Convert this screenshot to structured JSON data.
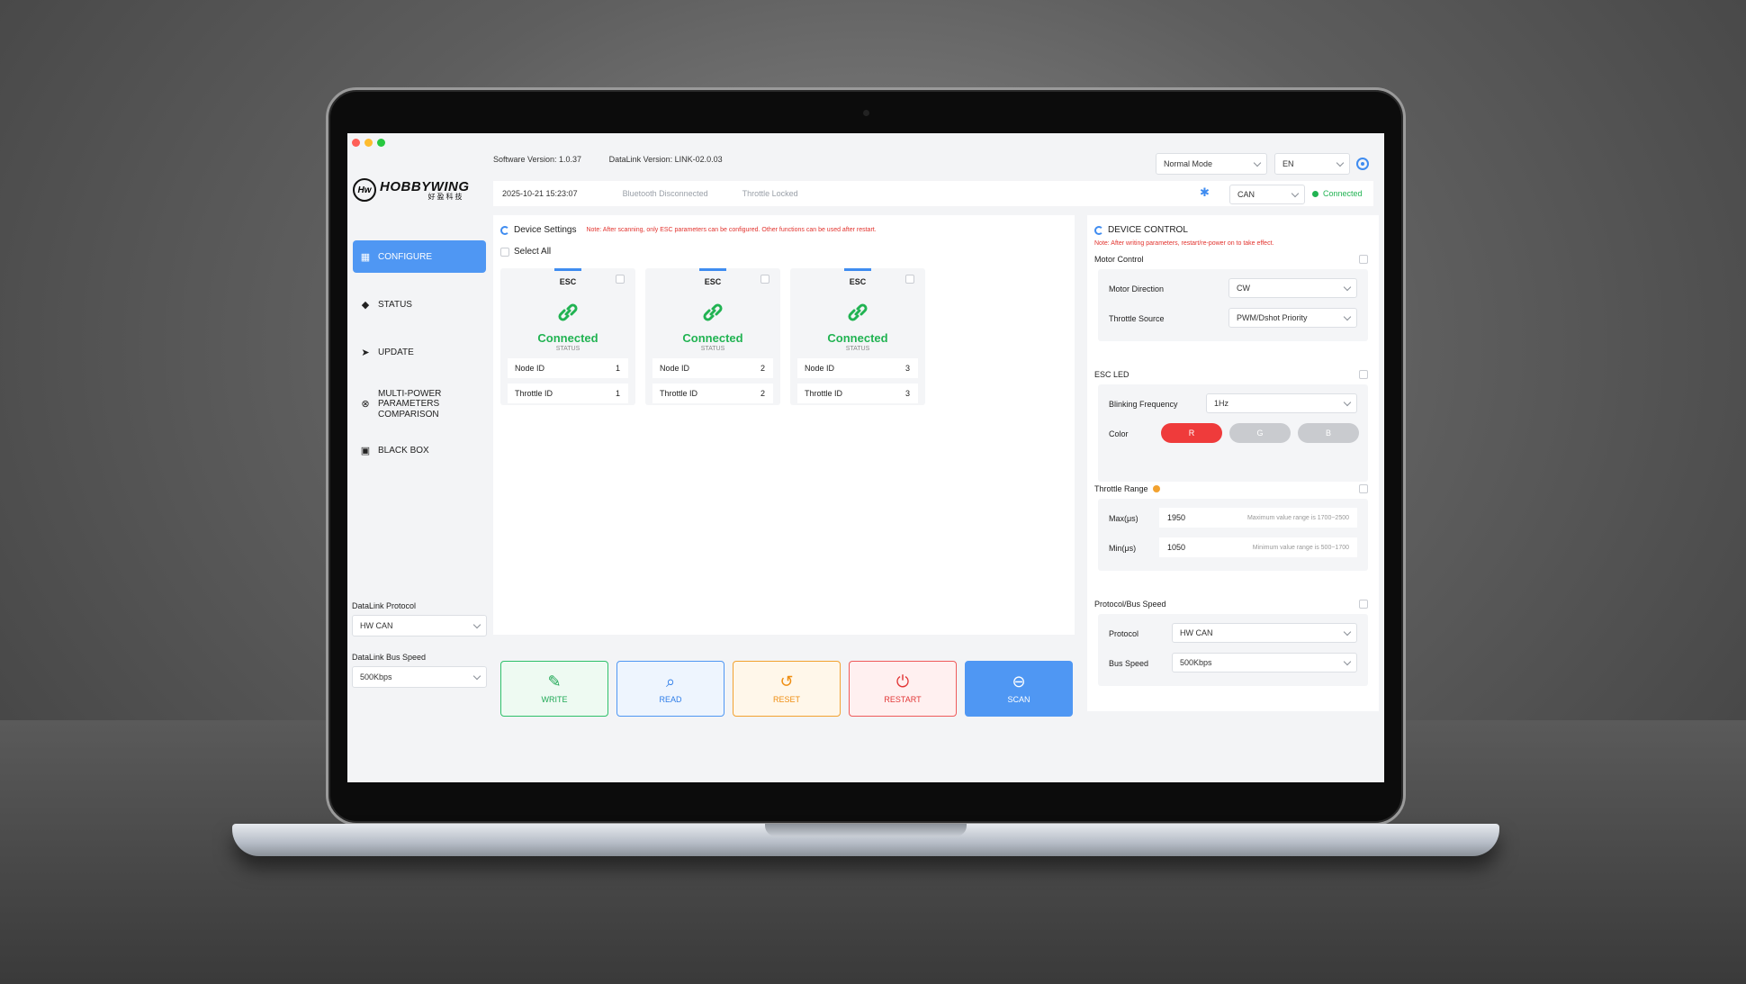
{
  "header": {
    "software_version": "Software Version:  1.0.37",
    "datalink_version": "DataLink Version:  LINK-02.0.03",
    "datetime": "2025-10-21 15:23:07",
    "bluetooth_status": "Bluetooth Disconnected",
    "throttle_status": "Throttle Locked",
    "mode": "Normal Mode",
    "language": "EN",
    "bus": "CAN",
    "connection": "Connected"
  },
  "logo": {
    "mark": "Hw",
    "name": "HOBBYWING",
    "sub": "好盈科技"
  },
  "sidebar": {
    "items": [
      {
        "label": "CONFIGURE",
        "icon": "grid-icon"
      },
      {
        "label": "STATUS",
        "icon": "layers-icon"
      },
      {
        "label": "UPDATE",
        "icon": "rocket-icon"
      },
      {
        "label": "MULTI-POWER PARAMETERS COMPARISON",
        "icon": "compare-icon"
      },
      {
        "label": "BLACK BOX",
        "icon": "box-icon"
      }
    ],
    "protocol_label": "DataLink Protocol",
    "protocol_value": "HW CAN",
    "bus_speed_label": "DataLink Bus Speed",
    "bus_speed_value": "500Kbps"
  },
  "device_settings": {
    "title": "Device Settings",
    "note": "Note: After scanning, only ESC parameters can be configured. Other functions can be used after restart.",
    "select_all": "Select All",
    "cards": [
      {
        "head": "ESC",
        "status": "Connected",
        "status_label": "STATUS",
        "node_label": "Node ID",
        "node_id": "1",
        "throttle_label": "Throttle ID",
        "throttle_id": "1"
      },
      {
        "head": "ESC",
        "status": "Connected",
        "status_label": "STATUS",
        "node_label": "Node ID",
        "node_id": "2",
        "throttle_label": "Throttle ID",
        "throttle_id": "2"
      },
      {
        "head": "ESC",
        "status": "Connected",
        "status_label": "STATUS",
        "node_label": "Node ID",
        "node_id": "3",
        "throttle_label": "Throttle ID",
        "throttle_id": "3"
      }
    ],
    "actions": {
      "write": "WRITE",
      "read": "READ",
      "reset": "RESET",
      "restart": "RESTART",
      "scan": "SCAN"
    }
  },
  "device_control": {
    "title": "DEVICE CONTROL",
    "note": "Note: After writing parameters, restart/re-power on to take effect.",
    "motor_control": {
      "title": "Motor Control",
      "direction_label": "Motor Direction",
      "direction_value": "CW",
      "throttle_source_label": "Throttle Source",
      "throttle_source_value": "PWM/Dshot Priority"
    },
    "esc_led": {
      "title": "ESC LED",
      "blink_label": "Blinking Frequency",
      "blink_value": "1Hz",
      "color_label": "Color",
      "r": "R",
      "g": "G",
      "b": "B"
    },
    "throttle_range": {
      "title": "Throttle Range",
      "max_label": "Max(μs)",
      "max_value": "1950",
      "max_hint": "Maximum value range is 1700~2500",
      "min_label": "Min(μs)",
      "min_value": "1050",
      "min_hint": "Minimum value range is 500~1700"
    },
    "protocol_bus": {
      "title": "Protocol/Bus Speed",
      "protocol_label": "Protocol",
      "protocol_value": "HW CAN",
      "bus_label": "Bus Speed",
      "bus_value": "500Kbps"
    }
  },
  "colors": {
    "accent": "#4f97f3",
    "success": "#21b352",
    "danger": "#e2332e",
    "warning": "#f2a230"
  }
}
